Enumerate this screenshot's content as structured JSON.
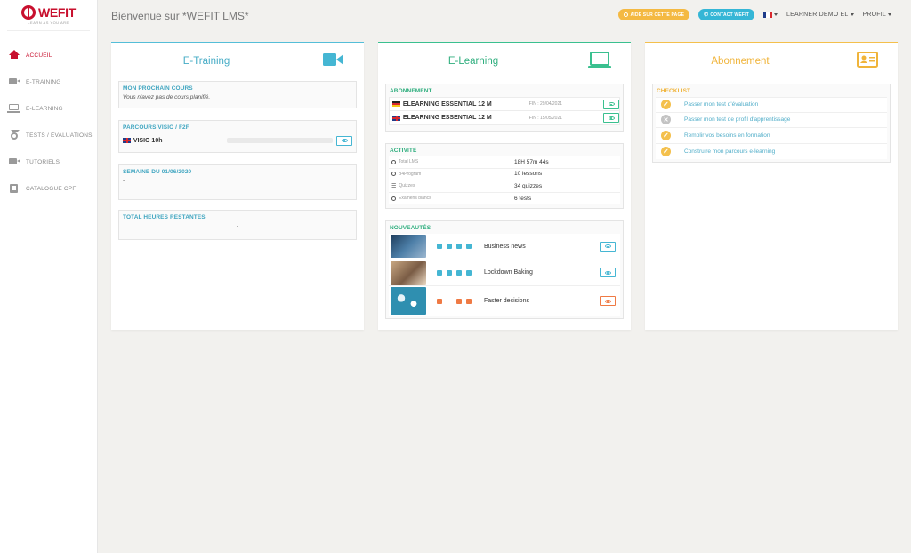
{
  "app": {
    "logo_text": "WEFIT",
    "logo_tagline": "LEARN AS YOU ARE",
    "page_title": "Bienvenue sur *WEFIT LMS*"
  },
  "sidebar": {
    "items": [
      {
        "label": "ACCUEIL",
        "icon": "home-icon",
        "active": true
      },
      {
        "label": "E-TRAINING",
        "icon": "video-camera-icon"
      },
      {
        "label": "E-LEARNING",
        "icon": "laptop-icon"
      },
      {
        "label": "TESTS / ÉVALUATIONS",
        "icon": "medal-icon"
      },
      {
        "label": "TUTORIELS",
        "icon": "video-camera-icon"
      },
      {
        "label": "CATALOGUE CPF",
        "icon": "book-icon"
      }
    ]
  },
  "topbar": {
    "help_button": "AIDE SUR CETTE PAGE",
    "contact_button": "CONTACT WEFIT",
    "user_menu": "LEARNER DEMO EL",
    "profile_menu": "PROFIL",
    "language": "fr"
  },
  "etraining": {
    "title": "E-Training",
    "next_course_head": "MON PROCHAIN COURS",
    "next_course_text": "Vous n'avez pas de cours planifié.",
    "parcours_head": "PARCOURS VISIO / F2F",
    "parcours_item": "VISIO 10h",
    "parcours_progress": 0,
    "week_head": "SEMAINE DU 01/06/2020",
    "week_text": "-",
    "hours_head": "TOTAL HEURES RESTANTES",
    "hours_text": "-"
  },
  "elearning": {
    "title": "E-Learning",
    "subscription_head": "ABONNEMENT",
    "subscriptions": [
      {
        "flag": "de",
        "name": "ELEARNING ESSENTIAL 12 M",
        "end": "FIN : 29/04/2021"
      },
      {
        "flag": "uk",
        "name": "ELEARNING ESSENTIAL 12 M",
        "end": "FIN : 15/05/2021"
      }
    ],
    "activity_head": "ACTIVITÉ",
    "activity": [
      {
        "label": "Total LMS",
        "value": "18H 57m 44s",
        "icon": "history-icon"
      },
      {
        "label": "B4Program",
        "value": "10 lessons",
        "icon": "clock-icon"
      },
      {
        "label": "Quizzes",
        "value": "34 quizzes",
        "icon": "list-icon"
      },
      {
        "label": "Examens blancs",
        "value": "6 tests",
        "icon": "medal-icon"
      }
    ],
    "news_head": "NOUVEAUTÉS",
    "news": [
      {
        "title": "Business news",
        "accent": "#45b6d3"
      },
      {
        "title": "Lockdown Baking",
        "accent": "#45b6d3"
      },
      {
        "title": "Faster decisions",
        "accent": "#ef7a44"
      }
    ]
  },
  "abonnement": {
    "title": "Abonnement",
    "checklist_head": "CHECKLIST",
    "items": [
      {
        "label": "Passer mon test d'évaluation",
        "done": true
      },
      {
        "label": "Passer mon test de profil d'apprentissage",
        "done": false
      },
      {
        "label": "Remplir vos besoins en formation",
        "done": true
      },
      {
        "label": "Construire mon parcours e-learning",
        "done": true
      }
    ]
  },
  "colors": {
    "brand": "#c8102e",
    "etraining": "#54bed8",
    "elearning": "#3ac08f",
    "abonnement": "#f4c04c"
  }
}
